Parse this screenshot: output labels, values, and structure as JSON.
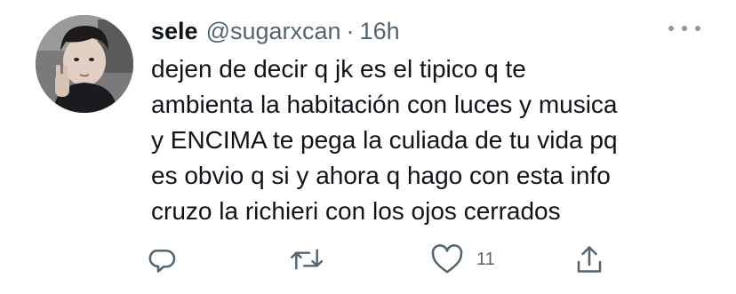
{
  "tweet": {
    "display_name": "sele",
    "handle": "@sugarxcan",
    "separator": "·",
    "timestamp": "16h",
    "lines": [
      "dejen de decir q jk es el tipico q te",
      "ambienta la habitación con luces y musica",
      "y ENCIMA te pega la culiada de tu vida pq",
      "es obvio q si y ahora q hago con esta info",
      "cruzo la richieri con los ojos cerrados"
    ]
  },
  "actions": {
    "reply_icon": "reply-icon",
    "retweet_icon": "retweet-icon",
    "like_icon": "heart-icon",
    "like_count": "11",
    "share_icon": "share-icon"
  },
  "colors": {
    "text": "#0f1419",
    "secondary": "#536471",
    "background": "#ffffff"
  }
}
